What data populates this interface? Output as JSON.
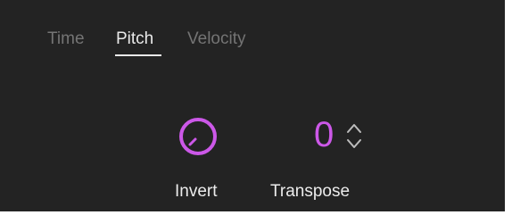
{
  "tabs": [
    {
      "label": "Time",
      "active": false
    },
    {
      "label": "Pitch",
      "active": true
    },
    {
      "label": "Velocity",
      "active": false
    }
  ],
  "controls": {
    "invert": {
      "label": "Invert",
      "icon": "knob-icon"
    },
    "transpose": {
      "label": "Transpose",
      "value": "0",
      "stepper_icons": [
        "chevron-up-icon",
        "chevron-down-icon"
      ]
    }
  },
  "colors": {
    "background": "#232323",
    "accent": "#cc58e8",
    "tab_active": "#e9e9e9",
    "tab_inactive": "#747474",
    "label": "#ececec",
    "stepper": "#bdbdbd"
  }
}
